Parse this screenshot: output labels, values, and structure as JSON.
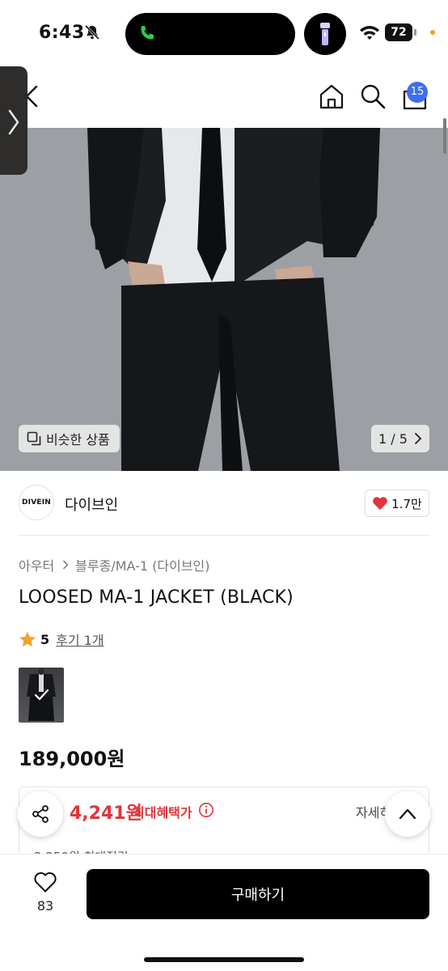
{
  "status_bar": {
    "time": "6:43",
    "battery": "72"
  },
  "header": {
    "cart_count": "15"
  },
  "gallery": {
    "similar_label": "비슷한 상품",
    "page_indicator": "1 / 5"
  },
  "brand": {
    "logo_text": "DIVEIN",
    "name": "다이브인",
    "likes": "1.7만"
  },
  "product": {
    "breadcrumb": [
      "아우터",
      "블루종/MA-1 (다이브인)"
    ],
    "title": "LOOSED MA-1 JACKET (BLACK)",
    "rating": "5",
    "reviews": "후기 1개",
    "price": "189,000원"
  },
  "benefit": {
    "price": "4,241원",
    "label": "최대혜택가",
    "detail_label": "자세히",
    "sub_text": "2,250원 최대적립"
  },
  "bottom": {
    "wish_count": "83",
    "buy_label": "구매하기"
  },
  "colors": {
    "accent_red": "#e2343b",
    "badge_blue": "#3c6ef0",
    "star": "#f3a426"
  }
}
